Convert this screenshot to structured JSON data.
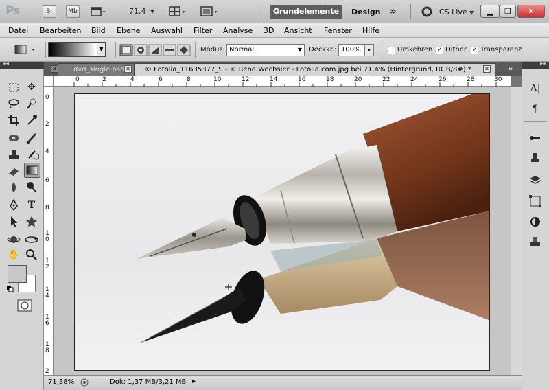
{
  "app": {
    "logo": "Ps",
    "bridge": "Br",
    "minibridge": "Mb",
    "zoom": "71,4",
    "workspace_active": "Grundelemente",
    "workspace_other": "Design",
    "workspace_more": "»",
    "cs_live": "CS Live"
  },
  "menu": [
    "Datei",
    "Bearbeiten",
    "Bild",
    "Ebene",
    "Auswahl",
    "Filter",
    "Analyse",
    "3D",
    "Ansicht",
    "Fenster",
    "Hilfe"
  ],
  "options": {
    "modus_label": "Modus:",
    "modus_value": "Normal",
    "deckkr_label": "Deckkr.:",
    "deckkr_value": "100%",
    "umkehren": "Umkehren",
    "dither": "Dither",
    "transparenz": "Transparenz"
  },
  "tabs": [
    {
      "label": "dvd_single.psd"
    },
    {
      "label": "© Fotolia_11635377_S - © Rene Wechsler - Fotolia.com.jpg bei 71,4% (Hintergrund, RGB/8#) *"
    }
  ],
  "tab_more": "»",
  "ruler_top": [
    "0",
    "2",
    "4",
    "6",
    "8",
    "10",
    "12",
    "14",
    "16",
    "18",
    "20",
    "22",
    "24",
    "26",
    "28",
    "30"
  ],
  "ruler_left": [
    "0",
    "2",
    "4",
    "6",
    "8",
    "1 0",
    "1 2",
    "1 4",
    "1 6",
    "1 8",
    "2"
  ],
  "status": {
    "zoom": "71,38%",
    "doc": "Dok: 1,37 MB/3,21 MB"
  },
  "colors": {
    "wood": "#8a4a2c",
    "chrome": "#c9c6c0",
    "accent_ws": "#5e5e5e"
  }
}
